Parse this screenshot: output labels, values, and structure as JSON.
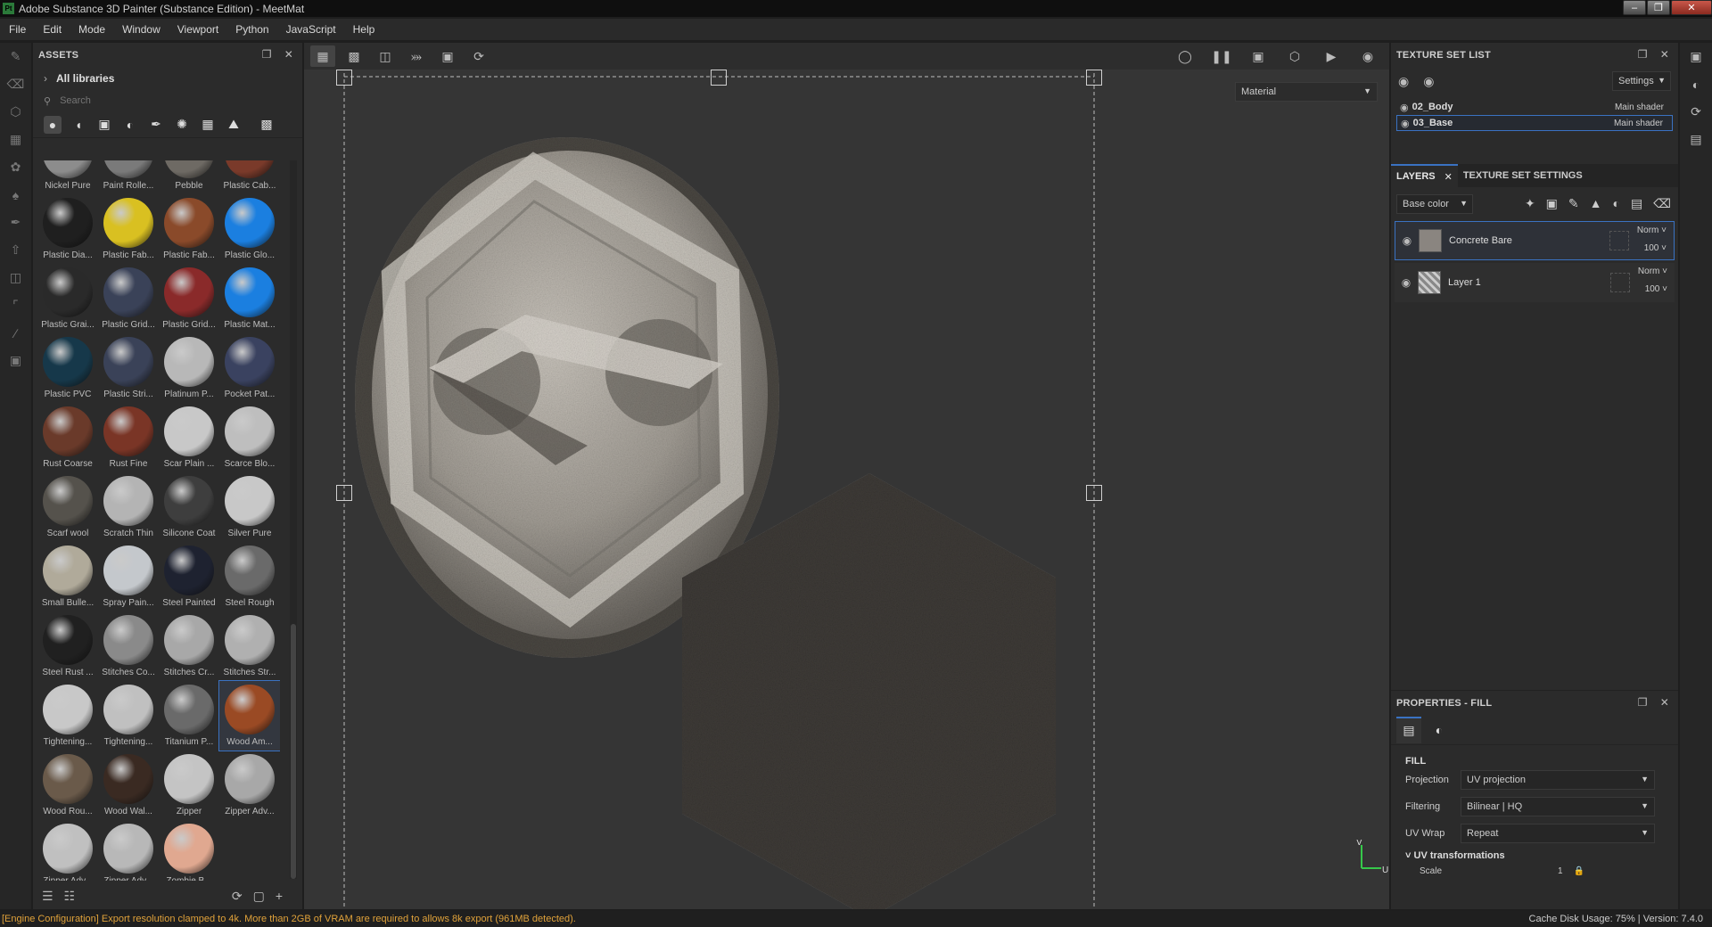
{
  "window": {
    "title": "Adobe Substance 3D Painter (Substance Edition) - MeetMat",
    "app_icon": "Pt"
  },
  "menu": [
    "File",
    "Edit",
    "Mode",
    "Window",
    "Viewport",
    "Python",
    "JavaScript",
    "Help"
  ],
  "assets": {
    "title": "ASSETS",
    "library": "All libraries",
    "search_placeholder": "Search",
    "materials": [
      {
        "label": "Nickel Pure",
        "color": "#8c8c8c"
      },
      {
        "label": "Paint Rolle...",
        "color": "#7a7a7a"
      },
      {
        "label": "Pebble",
        "color": "#6e6a64"
      },
      {
        "label": "Plastic Cab...",
        "color": "#7a3a2a"
      },
      {
        "label": "Plastic Dia...",
        "color": "#1f1f1f"
      },
      {
        "label": "Plastic Fab...",
        "color": "#d9c021"
      },
      {
        "label": "Plastic Fab...",
        "color": "#8a4a2a"
      },
      {
        "label": "Plastic Glo...",
        "color": "#1b7fe0"
      },
      {
        "label": "Plastic Grai...",
        "color": "#2a2a2a"
      },
      {
        "label": "Plastic Grid...",
        "color": "#3a4258"
      },
      {
        "label": "Plastic Grid...",
        "color": "#8a2a2a"
      },
      {
        "label": "Plastic Mat...",
        "color": "#1b7fe0"
      },
      {
        "label": "Plastic PVC",
        "color": "#16384a"
      },
      {
        "label": "Plastic Stri...",
        "color": "#3a4258"
      },
      {
        "label": "Platinum P...",
        "color": "#b8b8b8"
      },
      {
        "label": "Pocket Pat...",
        "color": "#3a4260"
      },
      {
        "label": "Rust Coarse",
        "color": "#6a3a2a"
      },
      {
        "label": "Rust Fine",
        "color": "#7a3526"
      },
      {
        "label": "Scar Plain ...",
        "color": "#c8c8c8"
      },
      {
        "label": "Scarce Blo...",
        "color": "#bebebe"
      },
      {
        "label": "Scarf wool",
        "color": "#55524c"
      },
      {
        "label": "Scratch Thin",
        "color": "#b4b4b4"
      },
      {
        "label": "Silicone Coat",
        "color": "#3e3e3e"
      },
      {
        "label": "Silver Pure",
        "color": "#c8c8c8"
      },
      {
        "label": "Small Bulle...",
        "color": "#b0aa9a"
      },
      {
        "label": "Spray Pain...",
        "color": "#c4c8cc"
      },
      {
        "label": "Steel Painted",
        "color": "#1e2230"
      },
      {
        "label": "Steel Rough",
        "color": "#6a6a6a"
      },
      {
        "label": "Steel Rust ...",
        "color": "#202020"
      },
      {
        "label": "Stitches Co...",
        "color": "#8a8a8a"
      },
      {
        "label": "Stitches Cr...",
        "color": "#a8a8a8"
      },
      {
        "label": "Stitches Str...",
        "color": "#b0b0b0"
      },
      {
        "label": "Tightening...",
        "color": "#c8c8c8"
      },
      {
        "label": "Tightening...",
        "color": "#c0c0c0"
      },
      {
        "label": "Titanium P...",
        "color": "#6a6a6a"
      },
      {
        "label": "Wood Am...",
        "color": "#9a4a24"
      },
      {
        "label": "Wood Rou...",
        "color": "#6a5a4a"
      },
      {
        "label": "Wood Wal...",
        "color": "#3a2a22"
      },
      {
        "label": "Zipper",
        "color": "#c4c4c4"
      },
      {
        "label": "Zipper Adv...",
        "color": "#a8a8a8"
      },
      {
        "label": "Zipper Adv...",
        "color": "#c0c0c0"
      },
      {
        "label": "Zipper Adv...",
        "color": "#b8b8b8"
      },
      {
        "label": "Zombie B...",
        "color": "#e0a890"
      }
    ]
  },
  "viewport": {
    "material_mode": "Material"
  },
  "texture_set_list": {
    "title": "TEXTURE SET LIST",
    "settings_label": "Settings",
    "sets": [
      {
        "name": "02_Body",
        "shader": "Main shader"
      },
      {
        "name": "03_Base",
        "shader": "Main shader"
      }
    ]
  },
  "layers": {
    "tab_layers": "LAYERS",
    "tab_settings": "TEXTURE SET SETTINGS",
    "channel": "Base color",
    "items": [
      {
        "name": "Concrete Bare",
        "blend": "Norm",
        "opacity": "100"
      },
      {
        "name": "Layer 1",
        "blend": "Norm",
        "opacity": "100"
      }
    ]
  },
  "properties": {
    "title": "PROPERTIES - FILL",
    "section": "FILL",
    "projection_label": "Projection",
    "projection_value": "UV projection",
    "filtering_label": "Filtering",
    "filtering_value": "Bilinear | HQ",
    "uvwrap_label": "UV Wrap",
    "uvwrap_value": "Repeat",
    "uv_transform": "UV transformations",
    "scale_label": "Scale",
    "scale_value": "1"
  },
  "status": {
    "message": "[Engine Configuration] Export resolution clamped to 4k. More than 2GB of VRAM are required to allows 8k export (961MB detected).",
    "right": "Cache Disk Usage:   75% | Version: 7.4.0"
  },
  "colors": {
    "accent": "#3a72c2",
    "warning": "#e0a23a"
  }
}
